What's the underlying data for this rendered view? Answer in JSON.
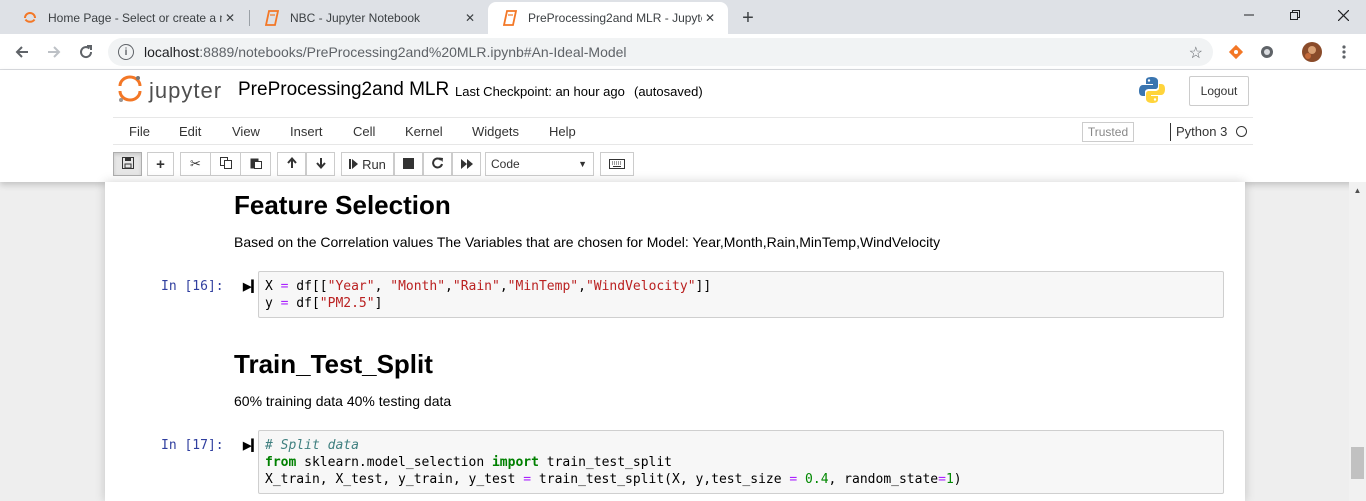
{
  "browser": {
    "tabs": [
      {
        "title": "Home Page - Select or create a n",
        "active": false,
        "icon": "jupyter-home-icon"
      },
      {
        "title": "NBC - Jupyter Notebook",
        "active": false,
        "icon": "notebook-icon"
      },
      {
        "title": "PreProcessing2and MLR - Jupyte",
        "active": true,
        "icon": "notebook-icon"
      }
    ],
    "url_host": "localhost",
    "url_rest": ":8889/notebooks/PreProcessing2and%20MLR.ipynb#An-Ideal-Model"
  },
  "jupyter": {
    "logo_text": "jupyter",
    "notebook_name": "PreProcessing2and MLR",
    "checkpoint": "Last Checkpoint: an hour ago",
    "autosave": "(autosaved)",
    "logout_label": "Logout",
    "menu": [
      "File",
      "Edit",
      "View",
      "Insert",
      "Cell",
      "Kernel",
      "Widgets",
      "Help"
    ],
    "trusted_label": "Trusted",
    "kernel_name": "Python 3",
    "toolbar": {
      "run_label": "Run",
      "cell_type": "Code"
    }
  },
  "notebook": {
    "heading1": "Feature Selection",
    "text1": "Based on the Correlation values The Variables that are chosen for Model: Year,Month,Rain,MinTemp,WindVelocity",
    "prompt1": "In [16]:",
    "heading2": "Train_Test_Split",
    "text2": "60% training data 40% testing data",
    "prompt2": "In [17]:"
  },
  "colors": {
    "accent_orange": "#f37726",
    "prompt_blue": "#303f9f",
    "string_red": "#ba2121",
    "keyword_green": "#008000"
  }
}
